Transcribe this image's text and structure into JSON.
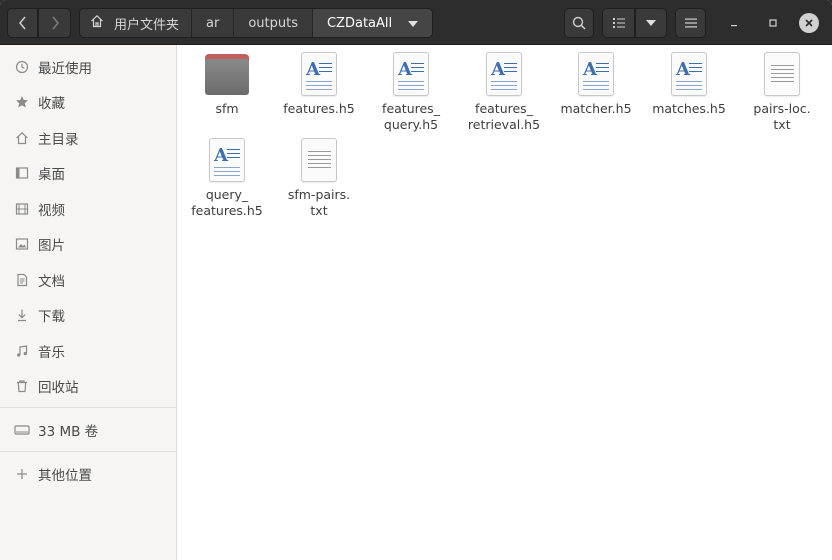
{
  "breadcrumb": {
    "items": [
      "用户文件夹",
      "ar",
      "outputs",
      "CZDataAll"
    ]
  },
  "icons": {
    "back": "chevron-left-icon",
    "forward": "chevron-right-icon",
    "home": "home-icon",
    "search": "search-icon",
    "list_view": "list-view-icon",
    "dropdown": "chevron-down-icon",
    "menu": "hamburger-menu-icon",
    "minimize": "minimize-icon",
    "maximize": "maximize-icon",
    "close": "close-icon"
  },
  "sidebar": {
    "items": [
      {
        "label": "最近使用",
        "icon": "clock-icon"
      },
      {
        "label": "收藏",
        "icon": "star-icon"
      },
      {
        "label": "主目录",
        "icon": "home-icon"
      },
      {
        "label": "桌面",
        "icon": "desktop-icon"
      },
      {
        "label": "视频",
        "icon": "video-icon"
      },
      {
        "label": "图片",
        "icon": "image-icon"
      },
      {
        "label": "文档",
        "icon": "document-icon"
      },
      {
        "label": "下载",
        "icon": "download-icon"
      },
      {
        "label": "音乐",
        "icon": "music-icon"
      },
      {
        "label": "回收站",
        "icon": "trash-icon"
      }
    ],
    "volume": {
      "label": "33 MB 卷",
      "icon": "drive-icon"
    },
    "other": {
      "label": "其他位置",
      "icon": "plus-icon"
    }
  },
  "files": [
    {
      "name": "sfm",
      "type": "folder"
    },
    {
      "name": "features.h5",
      "type": "doc"
    },
    {
      "name": "features_\nquery.h5",
      "type": "doc"
    },
    {
      "name": "features_\nretrieval.h5",
      "type": "doc"
    },
    {
      "name": "matcher.h5",
      "type": "doc"
    },
    {
      "name": "matches.h5",
      "type": "doc"
    },
    {
      "name": "pairs-loc.\ntxt",
      "type": "txt"
    },
    {
      "name": "query_\nfeatures.h5",
      "type": "doc"
    },
    {
      "name": "sfm-pairs.\ntxt",
      "type": "txt"
    }
  ]
}
